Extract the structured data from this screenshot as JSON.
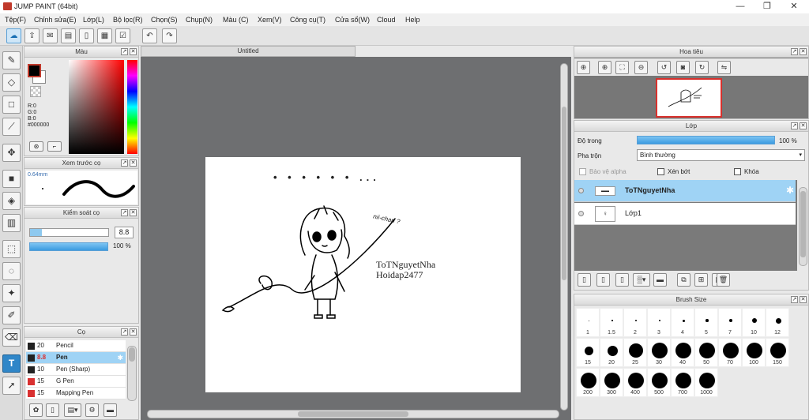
{
  "window": {
    "title": "JUMP PAINT (64bit)",
    "minimize": "—",
    "maximize": "❐",
    "close": "✕"
  },
  "menu": [
    "Tệp(F)",
    "Chỉnh sửa(E)",
    "Lớp(L)",
    "Bộ lọc(R)",
    "Chọn(S)",
    "Chụp(N)",
    "Màu (C)",
    "Xem(V)",
    "Công cụ(T)",
    "Cửa sổ(W)",
    "Cloud",
    "Help"
  ],
  "toolbar": {
    "icons": [
      "cloud-icon",
      "share-icon",
      "comment-icon",
      "notebook-icon",
      "page-icon",
      "page-settings-icon",
      "checklist-icon",
      "undo-icon",
      "redo-icon"
    ]
  },
  "tools": [
    "pen-tool-icon",
    "eraser-icon",
    "rect-select-icon",
    "brush-tool-icon",
    "move-icon",
    "fill-rect-icon",
    "bucket-icon",
    "gradient-icon",
    "dotted-select-icon",
    "lasso-icon",
    "magic-wand-icon",
    "select-pen-icon",
    "select-eraser-icon",
    "text-tool-icon",
    "pointer-icon"
  ],
  "color_panel": {
    "title": "Màu",
    "r": "R:0",
    "g": "G:0",
    "b": "B:0",
    "hex": "#000000",
    "primary": "#000000",
    "secondary": "#ffffff"
  },
  "preview_panel": {
    "title": "Xem trước cọ",
    "size": "0.64mm"
  },
  "control_panel": {
    "title": "Kiểm soát cọ",
    "size_value": "8.8",
    "opacity_value": "100 %"
  },
  "brush_panel": {
    "title": "Cọ",
    "items": [
      {
        "size": "20",
        "name": "Pencil",
        "color": "#222222"
      },
      {
        "size": "8.8",
        "name": "Pen",
        "color": "#222222"
      },
      {
        "size": "10",
        "name": "Pen (Sharp)",
        "color": "#222222"
      },
      {
        "size": "15",
        "name": "G Pen",
        "color": "#d93030"
      },
      {
        "size": "15",
        "name": "Mapping Pen",
        "color": "#d93030"
      }
    ]
  },
  "document": {
    "tab": "Untitled",
    "artwork": {
      "dots": "• • • • • • ...",
      "speech": "nii-chan ?",
      "watermark_line1": "ToTNguyetNha",
      "watermark_line2": "Hoidap2477"
    }
  },
  "navigator": {
    "title": "Hoa tiêu"
  },
  "layer_panel": {
    "title": "Lớp",
    "opacity_label": "Độ trong",
    "opacity_value": "100 %",
    "opacity_fraction": 1.0,
    "blend_label": "Pha trộn",
    "blend_value": "Bình thường",
    "protect_alpha": "Bảo vệ alpha",
    "clip": "Xén bớt",
    "lock": "Khóa",
    "layers": [
      {
        "name": "ToTNguyetNha",
        "selected": true
      },
      {
        "name": "Lớp1",
        "selected": false
      }
    ]
  },
  "brush_size_panel": {
    "title": "Brush Size",
    "sizes": [
      "1",
      "1.5",
      "2",
      "3",
      "4",
      "5",
      "7",
      "10",
      "12",
      "15",
      "20",
      "25",
      "30",
      "40",
      "50",
      "70",
      "100",
      "150",
      "200",
      "300",
      "400",
      "500",
      "700",
      "1000"
    ]
  },
  "colors": {
    "accent": "#2f86c8",
    "selection": "#9fd3f5",
    "canvas_bg": "#6e6f71"
  }
}
